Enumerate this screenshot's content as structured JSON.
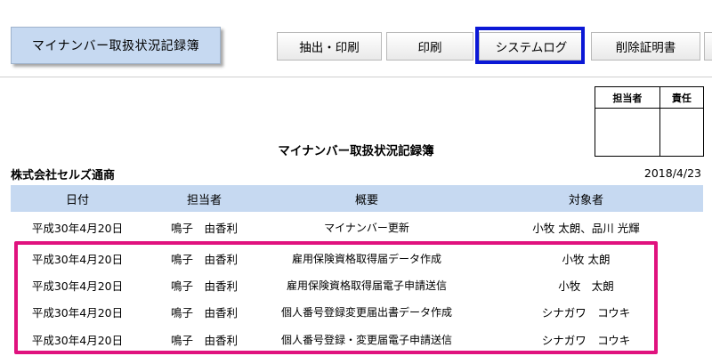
{
  "app": {
    "title": "マイナンバー取扱状況記録簿"
  },
  "toolbar": {
    "extract_print_label": "抽出・印刷",
    "print_label": "印刷",
    "system_log_label": "システムログ",
    "delete_cert_label": "削除証明書"
  },
  "stamp_box": {
    "staff_label": "担当者",
    "responsible_label": "責任"
  },
  "document": {
    "title": "マイナンバー取扱状況記録簿",
    "company": "株式会社セルズ通商",
    "date": "2018/4/23"
  },
  "log": {
    "columns": [
      "日付",
      "担当者",
      "概要",
      "対象者"
    ],
    "rows": [
      {
        "date": "平成30年4月20日",
        "staff": "鳴子　由香利",
        "summary": "マイナンバー更新",
        "target": "小牧 太朗、品川 光輝"
      },
      {
        "date": "平成30年4月20日",
        "staff": "鳴子　由香利",
        "summary": "雇用保険資格取得届データ作成",
        "target": "小牧 太朗"
      },
      {
        "date": "平成30年4月20日",
        "staff": "鳴子　由香利",
        "summary": "雇用保険資格取得届電子申請送信",
        "target": "小牧　太朗"
      },
      {
        "date": "平成30年4月20日",
        "staff": "鳴子　由香利",
        "summary": "個人番号登録変更届出書データ作成",
        "target": "シナガワ　コウキ"
      },
      {
        "date": "平成30年4月20日",
        "staff": "鳴子　由香利",
        "summary": "個人番号登録・変更届電子申請送信",
        "target": "シナガワ　コウキ"
      }
    ]
  },
  "colors": {
    "header_bg": "#c6d9f1",
    "system_log_highlight": "#0b18d6",
    "selection_highlight": "#e0127e"
  }
}
